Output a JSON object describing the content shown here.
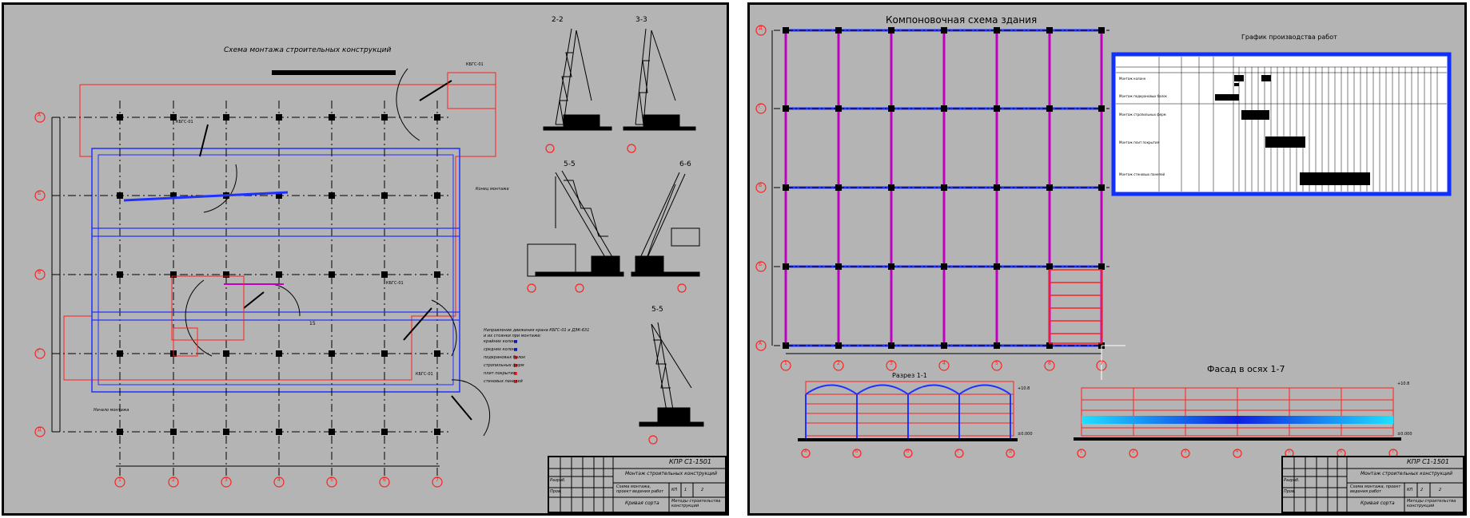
{
  "left_sheet": {
    "title": "Схема монтажа строительных конструкций",
    "section_22": "2-2",
    "section_33": "3-3",
    "section_55": "5-5",
    "section_66": "6-6",
    "section_55b": "5-5",
    "crane_label_1": "КБГС-01",
    "crane_label_2": "КБГС-01",
    "crane_label_3": "КБГС-01",
    "crane_label_4": "КБГС-01",
    "end_mount_label": "Конец монтажа",
    "start_mount_label": "Начало монтажа",
    "dim_label": "15",
    "row_axes": [
      "А",
      "Б",
      "В",
      "Г",
      "Д"
    ],
    "col_axes": [
      "1",
      "2",
      "3",
      "4",
      "5",
      "6",
      "7"
    ],
    "legend": {
      "title": "Направление движения крана КБГС-01 и ДЭК-631",
      "subtitle": "и их стоянки при монтаже:",
      "items": [
        "крайних колонн",
        "средних колонн",
        "подкрановых балок",
        "стропильных ферм",
        "плит покрытия",
        "стеновых панелей"
      ]
    },
    "title_block": {
      "code": "КПР С1-1501",
      "work_title": "Монтаж строительных конструкций",
      "doc_title": "Схема монтажа, проект ведения работ",
      "role_1": "Разраб.",
      "role_2": "Пров.",
      "org": "Кривая сорта",
      "footer": "Методы строительства конструкций",
      "sheet": "1",
      "sheets": "2",
      "stage": "КП"
    }
  },
  "right_sheet": {
    "layout_title": "Компоновочная схема здания",
    "schedule_title": "График производства работ",
    "section_title": "Разрез 1-1",
    "facade_title": "Фасад в осях 1-7",
    "row_axes": [
      "Д",
      "Г",
      "В",
      "Б",
      "А"
    ],
    "col_axes": [
      "1",
      "2",
      "3",
      "4",
      "5",
      "6",
      "7"
    ],
    "section_axes": [
      "А",
      "Б",
      "В",
      "Г",
      "Д"
    ],
    "facade_axes": [
      "1",
      "2",
      "3",
      "4",
      "5",
      "6",
      "7"
    ],
    "elev_1": "+10.8",
    "elev_2": "±0.000",
    "elev_3": "+10.8",
    "elev_4": "±0.000",
    "schedule_rows": [
      "Монтаж колонн",
      "Монтаж подкрановых балок",
      "Монтаж стропильных ферм",
      "Монтаж плит покрытия",
      "Монтаж стеновых панелей"
    ],
    "title_block": {
      "code": "КПР С1-1501",
      "work_title": "Монтаж строительных конструкций",
      "doc_title": "Схема монтажа, проект ведения работ",
      "role_1": "Разраб.",
      "role_2": "Пров.",
      "org": "Кривая сорта",
      "footer": "Методы строительства конструкций",
      "sheet": "2",
      "sheets": "2",
      "stage": "КП"
    }
  },
  "colors": {
    "sheet_bg": "#b4b4b4",
    "axis_red": "#ff2020",
    "grid_blue": "#2030ff",
    "purple": "#c000c0",
    "black": "#000000",
    "cyan": "#20e0ff"
  }
}
